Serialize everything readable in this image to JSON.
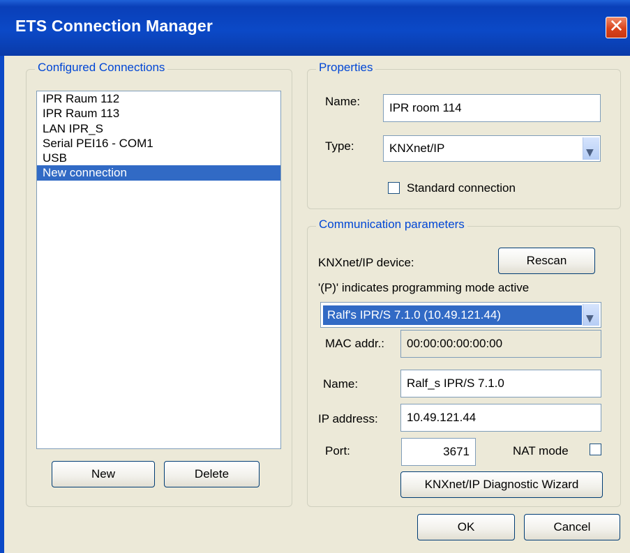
{
  "window": {
    "title": "ETS Connection Manager"
  },
  "configured": {
    "legend": "Configured Connections",
    "items": [
      {
        "label": "IPR Raum 112",
        "selected": false
      },
      {
        "label": "IPR Raum 113",
        "selected": false
      },
      {
        "label": "LAN IPR_S",
        "selected": false
      },
      {
        "label": "Serial PEI16 - COM1",
        "selected": false
      },
      {
        "label": "USB",
        "selected": false
      },
      {
        "label": "New connection",
        "selected": true
      }
    ],
    "new_label": "New",
    "delete_label": "Delete"
  },
  "properties": {
    "legend": "Properties",
    "name_label": "Name:",
    "name_value": "IPR room 114",
    "type_label": "Type:",
    "type_value": "KNXnet/IP",
    "standard_label": "Standard connection",
    "standard_checked": false
  },
  "comm": {
    "legend": "Communication parameters",
    "device_label": "KNXnet/IP device:",
    "rescan_label": "Rescan",
    "hint": "'(P)' indicates programming mode active",
    "device_value": "Ralf's IPR/S 7.1.0 (10.49.121.44)",
    "mac_label": "MAC addr.:",
    "mac_value": "00:00:00:00:00:00",
    "name_label": "Name:",
    "name_value": "Ralf_s IPR/S 7.1.0",
    "ip_label": "IP address:",
    "ip_value": "10.49.121.44",
    "port_label": "Port:",
    "port_value": "3671",
    "nat_label": "NAT mode",
    "nat_checked": false,
    "diag_label": "KNXnet/IP Diagnostic Wizard"
  },
  "footer": {
    "ok_label": "OK",
    "cancel_label": "Cancel"
  },
  "colors": {
    "titlebar": "#0b49c7",
    "selection": "#316ac5",
    "legend": "#0046d5",
    "dialog_bg": "#ece9d8"
  }
}
